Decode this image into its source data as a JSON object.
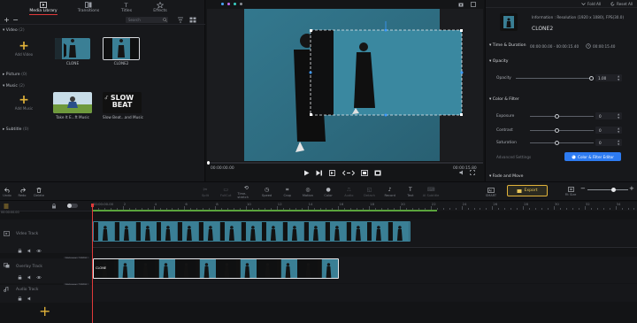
{
  "library": {
    "tabs": [
      {
        "label": "Media Library",
        "icon": "media-library-icon",
        "active": true
      },
      {
        "label": "Transitions",
        "icon": "transitions-icon",
        "active": false
      },
      {
        "label": "Titles",
        "icon": "titles-icon",
        "active": false
      },
      {
        "label": "Effects",
        "icon": "effects-icon",
        "active": false
      }
    ],
    "search_placeholder": "Search",
    "categories": {
      "video": {
        "label": "Video",
        "count": "(2)"
      },
      "picture": {
        "label": "Picture",
        "count": "(0)"
      },
      "music": {
        "label": "Music",
        "count": "(2)"
      },
      "subtitle": {
        "label": "Subtitle",
        "count": "(0)"
      }
    },
    "add_video": "Add Video",
    "add_music": "Add Music",
    "video_items": [
      {
        "label": "CLONE"
      },
      {
        "label": "CLONE2"
      }
    ],
    "music_items": [
      {
        "label": "Take It E...ft Music"
      },
      {
        "label": "Slow Beat...and Music",
        "thumb_text": "SLOW BEAT"
      }
    ]
  },
  "preview": {
    "time_current": "00:00:00.00",
    "time_total": "00:00:15.80"
  },
  "props": {
    "fold_all": "Fold All",
    "reset_all": "Reset All",
    "info": "Information : Resolution (1920 x 1080), FPS(30.0)",
    "clip_name": "CLONE2",
    "sections": {
      "time": "Time & Duration",
      "opacity": "Opacity",
      "color": "Color & Filter",
      "fade": "Fade and Move"
    },
    "time_range": "00:00:00.00 - 00:00:15.40",
    "duration": "00:00:15.40",
    "opacity_label": "Opacity",
    "opacity_value": "1.00",
    "opacity_level": 1.0,
    "exposure_label": "Exposure",
    "exposure_value": "0",
    "contrast_label": "Contrast",
    "contrast_value": "0",
    "saturation_label": "Saturation",
    "saturation_value": "0",
    "advanced": "Advanced Settings",
    "editor_btn": "Color & Filter Editor"
  },
  "toolbar": {
    "undo": "Undo",
    "redo": "Redo",
    "delete": "Delete",
    "tools": [
      "Split",
      "FullCut",
      "Time-stretch",
      "Speed",
      "Crop",
      "Motion",
      "Color",
      "Audio",
      "Detach",
      "Record",
      "Text",
      "AI Subtitle"
    ],
    "dimmed": [
      true,
      true,
      false,
      false,
      false,
      false,
      false,
      true,
      true,
      false,
      false,
      true
    ],
    "smart": "SMART",
    "export": "Export",
    "fit": "Fit Size"
  },
  "timeline": {
    "current_time": "00:00:00.00",
    "ruler_labels": [
      "00:00:00.00",
      "2",
      "4",
      "6",
      "8",
      "10",
      "12",
      "14",
      "16",
      "18",
      "20",
      "22",
      "24",
      "26",
      "28",
      "30",
      "32",
      "34"
    ],
    "tracks": [
      {
        "label": "Video Track",
        "volume": "Volume: 100%"
      },
      {
        "label": "Overlay Track",
        "volume": "Volume: 100%"
      },
      {
        "label": "Audio Track"
      }
    ],
    "clip_label": "CLONE"
  }
}
